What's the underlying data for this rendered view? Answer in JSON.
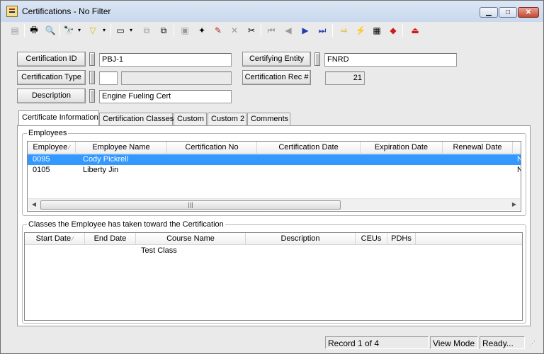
{
  "window": {
    "title": "Certifications - No Filter",
    "min_glyph": "▁",
    "max_glyph": "□",
    "close_glyph": "✕"
  },
  "toolbar": {
    "buttons": [
      {
        "name": "record-nav-icon",
        "glyph": "▤",
        "enabled": false
      },
      {
        "name": "print-icon",
        "glyph": "🖶",
        "enabled": true
      },
      {
        "name": "print-preview-icon",
        "glyph": "🔍",
        "enabled": true
      },
      {
        "name": "find-icon",
        "glyph": "🔭",
        "enabled": true
      },
      {
        "name": "filter-icon",
        "glyph": "▽",
        "enabled": true
      },
      {
        "name": "report-icon",
        "glyph": "▭",
        "enabled": true
      },
      {
        "name": "copy-record-icon",
        "glyph": "⧉",
        "enabled": false
      },
      {
        "name": "duplicate-icon",
        "glyph": "⧉",
        "enabled": true
      },
      {
        "name": "save-icon",
        "glyph": "▣",
        "enabled": false
      },
      {
        "name": "new-record-icon",
        "glyph": "✦",
        "enabled": true
      },
      {
        "name": "edit-pencil-icon",
        "glyph": "✎",
        "enabled": true
      },
      {
        "name": "delete-icon",
        "glyph": "✕",
        "enabled": false
      },
      {
        "name": "cut-icon",
        "glyph": "✂",
        "enabled": true
      },
      {
        "name": "first-record-icon",
        "glyph": "⏮",
        "enabled": false
      },
      {
        "name": "previous-record-icon",
        "glyph": "◀",
        "enabled": false
      },
      {
        "name": "next-record-icon",
        "glyph": "▶",
        "enabled": true
      },
      {
        "name": "last-record-icon",
        "glyph": "⏭",
        "enabled": true
      },
      {
        "name": "goto-arrow-icon",
        "glyph": "⇨",
        "enabled": true
      },
      {
        "name": "lightning-icon",
        "glyph": "⚡",
        "enabled": true
      },
      {
        "name": "image-icon",
        "glyph": "▦",
        "enabled": true
      },
      {
        "name": "book-icon",
        "glyph": "◆",
        "enabled": true
      },
      {
        "name": "exit-icon",
        "glyph": "⏏",
        "enabled": true
      }
    ],
    "drop_glyph": "▾",
    "colors": {
      "filter": "#d8b400",
      "nav": "#1f3fb0",
      "goto": "#e0b000",
      "exit": "#cc1d1d",
      "pencil": "#b52a2a"
    }
  },
  "form": {
    "certification_id": {
      "label": "Certification ID",
      "value": "PBJ-1"
    },
    "certification_type": {
      "label": "Certification Type",
      "value": "",
      "value2": ""
    },
    "description": {
      "label": "Description",
      "value": "Engine Fueling Cert"
    },
    "certifying_entity": {
      "label": "Certifying Entity",
      "value": "FNRD"
    },
    "certification_rec": {
      "label": "Certification Rec #",
      "value": "21"
    }
  },
  "tabs": [
    {
      "label": "Certificate Information",
      "active": true
    },
    {
      "label": "Certification Classes",
      "active": false
    },
    {
      "label": "Custom",
      "active": false
    },
    {
      "label": "Custom 2",
      "active": false
    },
    {
      "label": "Comments",
      "active": false
    }
  ],
  "employees": {
    "group_label": "Employees",
    "columns": [
      "Employee",
      "Employee Name",
      "Certification No",
      "Certification Date",
      "Expiration Date",
      "Renewal Date"
    ],
    "sort_glyph": "⁄",
    "rows": [
      {
        "id": "0095",
        "name": "Cody Pickrell",
        "cert_no": "",
        "cert_date": "",
        "exp_date": "",
        "renewal": "",
        "overflow": "N",
        "selected": true
      },
      {
        "id": "0105",
        "name": "Liberty Jin",
        "cert_no": "",
        "cert_date": "",
        "exp_date": "",
        "renewal": "",
        "overflow": "N",
        "selected": false
      }
    ],
    "scroll_left": "◀",
    "scroll_right": "▶",
    "thumb_grip": "|||"
  },
  "classes": {
    "group_label": "Classes the Employee has taken toward the Certification",
    "columns": [
      "Start Date",
      "End Date",
      "Course Name",
      "Description",
      "CEUs",
      "PDHs"
    ],
    "sort_glyph": "⁄",
    "rows": [
      {
        "start": "",
        "end": "",
        "course": "Test Class",
        "description": "",
        "ceus": "",
        "pdhs": ""
      }
    ]
  },
  "status": {
    "record": "Record 1 of 4",
    "mode": "View Mode",
    "state": "Ready...",
    "grip": "⋰"
  }
}
